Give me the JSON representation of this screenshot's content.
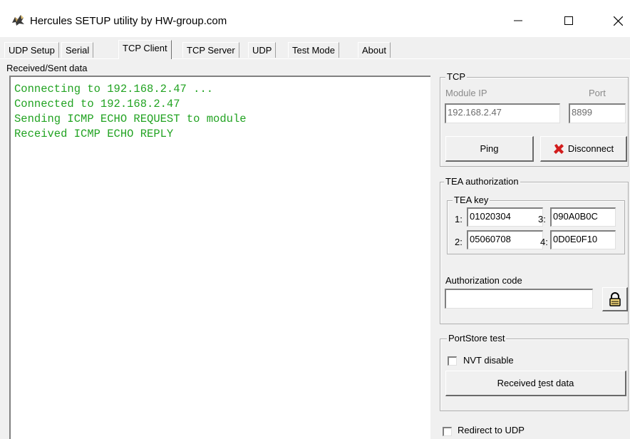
{
  "window": {
    "title": "Hercules SETUP utility by HW-group.com",
    "icon": "hercules-logo-icon",
    "controls": {
      "minimize": "minimize-icon",
      "maximize": "maximize-icon",
      "close": "close-icon"
    }
  },
  "tabs": [
    {
      "label": "UDP Setup",
      "active": false
    },
    {
      "label": "Serial",
      "active": false
    },
    {
      "label": "TCP Client",
      "active": true
    },
    {
      "label": "TCP Server",
      "active": false
    },
    {
      "label": "UDP",
      "active": false
    },
    {
      "label": "Test Mode",
      "active": false
    },
    {
      "label": "About",
      "active": false
    }
  ],
  "received_sent": {
    "label": "Received/Sent data",
    "lines": [
      "Connecting to 192.168.2.47 ...",
      "Connected to 192.168.2.47",
      "Sending ICMP ECHO REQUEST to module",
      "Received ICMP ECHO REPLY"
    ],
    "text_color": "#22a322"
  },
  "tcp": {
    "group_label": "TCP",
    "module_ip_label": "Module IP",
    "module_ip_value": "192.168.2.47",
    "port_label": "Port",
    "port_value": "8899",
    "ping_label": "Ping",
    "disconnect_label": "Disconnect",
    "disconnect_icon": "red-x-icon"
  },
  "tea": {
    "group_label": "TEA authorization",
    "key_group_label": "TEA key",
    "keys": [
      {
        "label": "1:",
        "value": "01020304"
      },
      {
        "label": "3:",
        "value": "090A0B0C"
      },
      {
        "label": "2:",
        "value": "05060708"
      },
      {
        "label": "4:",
        "value": "0D0E0F10"
      }
    ],
    "auth_code_label": "Authorization code",
    "auth_code_value": "",
    "lock_icon": "padlock-icon"
  },
  "portstore": {
    "group_label": "PortStore test",
    "nvt_disable_label": "NVT disable",
    "nvt_disable_checked": false,
    "received_test_data_label_pre": "Received ",
    "received_test_data_label_u": "t",
    "received_test_data_label_post": "est data"
  },
  "redirect_udp": {
    "label": "Redirect to UDP",
    "checked": false
  }
}
